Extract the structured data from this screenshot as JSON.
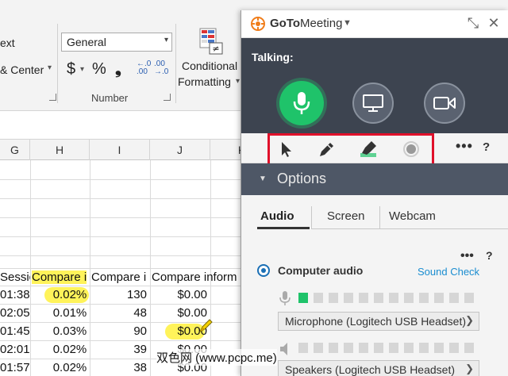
{
  "ribbon": {
    "wrap_text_fragment": "ext",
    "merge_center_fragment": "& Center",
    "number_format": "General",
    "currency_symbol": "$",
    "percent_symbol": "%",
    "comma_symbol": "❟",
    "inc_decimal": "←.0 .00",
    "dec_decimal": ".00 →.0",
    "conditional_formatting_line1": "Conditional",
    "conditional_formatting_line2": "Formatting",
    "number_group_label": "Number"
  },
  "sheet": {
    "columns": [
      "G",
      "H",
      "I",
      "J",
      "K"
    ],
    "header_row": [
      "Sessic",
      "Compare i",
      "Compare i",
      "Compare inform"
    ],
    "rows": [
      [
        "01:38",
        "0.02%",
        "130",
        "$0.00"
      ],
      [
        "02:05",
        "0.01%",
        "48",
        "$0.00"
      ],
      [
        "01:45",
        "0.03%",
        "90",
        "$0.00"
      ],
      [
        "02:01",
        "0.02%",
        "39",
        "$0.00"
      ],
      [
        "01:57",
        "0.02%",
        "38",
        "$0.00"
      ]
    ]
  },
  "gtm": {
    "app_name_bold": "GoTo",
    "app_name_rest": "Meeting",
    "talking_label": "Talking:",
    "more_label": "•••",
    "help_label": "?",
    "options_label": "Options",
    "tabs": [
      "Audio",
      "Screen",
      "Webcam"
    ],
    "computer_audio_label": "Computer audio",
    "sound_check_label": "Sound Check",
    "microphone_device": "Microphone (Logitech USB Headset)",
    "speakers_device": "Speakers (Logitech USB Headset)",
    "mic_level_segments": 12,
    "mic_level_active": 1
  },
  "watermark": "双色网 (www.pcpc.me)",
  "colors": {
    "gtm_dark": "#3d4450",
    "mic_green": "#1fc36a",
    "highlight_red": "#e0102a",
    "link_blue": "#1a8dd0",
    "yellow_highlight": "#fff35a"
  }
}
